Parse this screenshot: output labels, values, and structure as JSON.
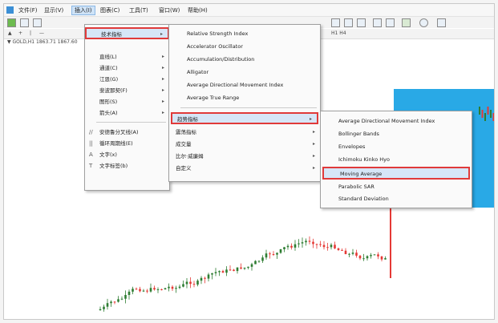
{
  "menubar": {
    "items": [
      "文件(F)",
      "显示(V)",
      "插入(I)",
      "图表(C)",
      "工具(T)",
      "窗口(W)",
      "帮助(H)"
    ]
  },
  "symbol_bar": {
    "text": "▼ GOLD,H1  1863.71 1867.60"
  },
  "toolbar": {
    "timeframes": "H1  H4"
  },
  "insert_menu": {
    "items": [
      {
        "label": "技术指标",
        "arrow": "▸"
      },
      {
        "label": "直线(L)",
        "arrow": "▸"
      },
      {
        "label": "通道(C)",
        "arrow": "▸"
      },
      {
        "label": "江恩(G)",
        "arrow": "▸"
      },
      {
        "label": "斐波那契(F)",
        "arrow": "▸"
      },
      {
        "label": "图形(S)",
        "arrow": "▸"
      },
      {
        "label": "箭头(A)",
        "arrow": "▸"
      },
      {
        "label": "安德鲁分叉线(A)",
        "arrow": ""
      },
      {
        "label": "循环周期线(E)",
        "arrow": ""
      },
      {
        "label": "文字(x)",
        "arrow": ""
      },
      {
        "label": "文字标签(b)",
        "arrow": ""
      }
    ]
  },
  "indicator_menu": {
    "items": [
      "Relative Strength Index",
      "Accelerator Oscillator",
      "Accumulation/Distribution",
      "Alligator",
      "Average Directional Movement Index",
      "Average True Range"
    ],
    "groups": [
      "趋势指标",
      "震荡指标",
      "成交量",
      "比尔·威廉姆",
      "自定义"
    ]
  },
  "trend_menu": {
    "items": [
      "Average Directional Movement Index",
      "Bollinger Bands",
      "Envelopes",
      "Ichimoku Kinko Hyo",
      "Moving Average",
      "Parabolic SAR",
      "Standard Deviation"
    ]
  },
  "colors": {
    "highlight_border": "#e03a3a",
    "highlight_bg": "#d6e6f7",
    "bull_candle": "#2e7d32",
    "bear_candle": "#e53935",
    "panel_blue": "#29a9e6"
  }
}
